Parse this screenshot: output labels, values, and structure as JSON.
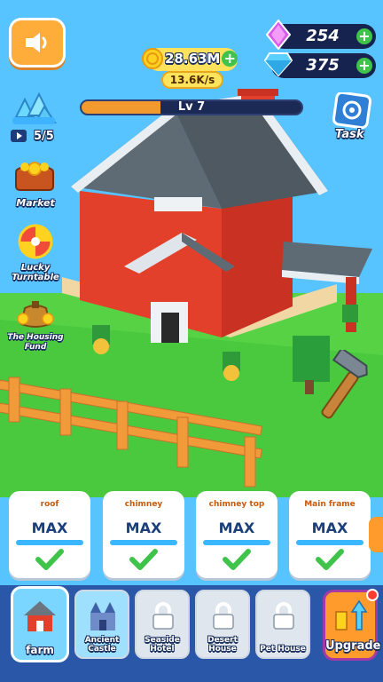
{
  "top": {
    "coins": "28.63M",
    "coin_rate": "13.6K/s",
    "gems_purple": "254",
    "gems_blue": "375"
  },
  "level": {
    "label": "Lv 7",
    "progress": 0.36
  },
  "side_left": {
    "crystals_count": "5/5",
    "market_label": "Market",
    "turntable_label": "Lucky Turntable",
    "fund_label": "The Housing Fund"
  },
  "side_right": {
    "task_label": "Task"
  },
  "cards": [
    {
      "title": "roof",
      "status": "MAX"
    },
    {
      "title": "chimney",
      "status": "MAX"
    },
    {
      "title": "chimney top",
      "status": "MAX"
    },
    {
      "title": "Main frame",
      "status": "MAX"
    }
  ],
  "bottom": {
    "tiles": [
      {
        "label": "farm",
        "locked": false,
        "selected": true
      },
      {
        "label": "Ancient Castle",
        "locked": false,
        "selected": false
      },
      {
        "label": "Seaside Hotel",
        "locked": true,
        "selected": false
      },
      {
        "label": "Desert House",
        "locked": true,
        "selected": false
      },
      {
        "label": "Pet House",
        "locked": true,
        "selected": false
      }
    ],
    "upgrade_label": "Upgrade"
  },
  "colors": {
    "sky": "#57c3ff",
    "grass": "#49c93f",
    "house_red": "#e23f2b",
    "roof_gray": "#5e6a74",
    "accent_orange": "#ffad3a",
    "bottom_bar": "#2b57a8"
  }
}
